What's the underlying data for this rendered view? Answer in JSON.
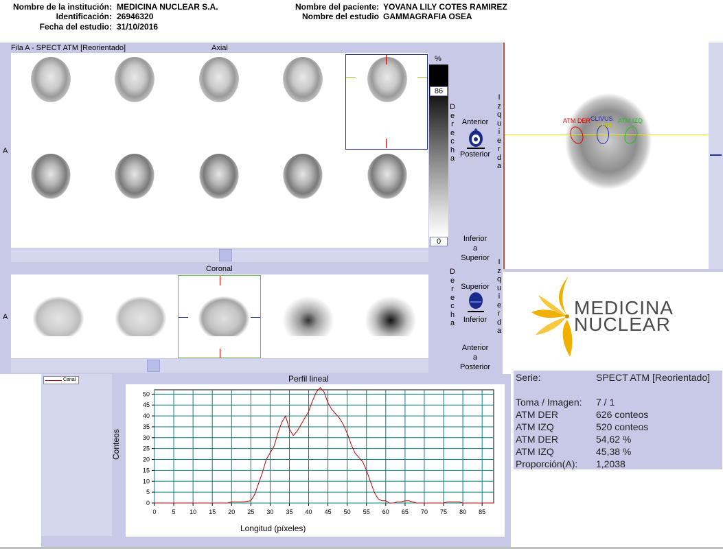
{
  "header": {
    "institution_label": "Nombre de la institución:",
    "institution": "MEDICINA NUCLEAR S.A.",
    "id_label": "Identificación:",
    "id": "26946320",
    "date_label": "Fecha del estudio:",
    "date": "31/10/2016",
    "patient_label": "Nombre del paciente:",
    "patient": "YOVANA LILY COTES RAMIREZ",
    "study_label": "Nombre del estudio",
    "study": "GAMMAGRAFIA OSEA"
  },
  "axial_panel": {
    "row_label": "Fila A - SPECT ATM [Reorientado]",
    "title": "Axial",
    "side_letter": "A"
  },
  "coronal_panel": {
    "title": "Coronal",
    "side_letter": "A"
  },
  "colorbar": {
    "unit": "%",
    "max_value": "86",
    "min_value": "0"
  },
  "orientation": {
    "derecha_letters": [
      "D",
      "e",
      "r",
      "e",
      "c",
      "h",
      "a"
    ],
    "izquierda_letters": [
      "I",
      "z",
      "q",
      "u",
      "i",
      "e",
      "r",
      "d",
      "a"
    ],
    "anterior": "Anterior",
    "posterior": "Posterior",
    "inferior_a_superior": [
      "Inferior",
      "a",
      "Superior"
    ],
    "superior": "Superior",
    "inferior": "Inferior",
    "anterior_a_posterior": [
      "Anterior",
      "a",
      "Posterior"
    ]
  },
  "roi_labels": {
    "atm_der": "ATM DER",
    "clivus": "CLIVUS",
    "perfil": "PERFIL",
    "atm_izq": "ATM IZQ"
  },
  "logo": {
    "line1": "MEDICINA",
    "line2": "NUCLEAR"
  },
  "profile": {
    "legend": "Canal",
    "title": "Perfil lineal",
    "xlabel": "Longitud (píxeles)",
    "ylabel": "Conteos"
  },
  "results": {
    "serie_label": "Serie:",
    "serie_value": "SPECT ATM [Reorientado]",
    "rows": [
      {
        "label": "Toma / Imagen:",
        "value": "7 / 1"
      },
      {
        "label": "ATM DER",
        "value": "626 conteos"
      },
      {
        "label": "ATM IZQ",
        "value": "520 conteos"
      },
      {
        "label": "ATM DER",
        "value": "54,62 %"
      },
      {
        "label": "ATM IZQ",
        "value": "45,38 %"
      },
      {
        "label": "Proporción(A):",
        "value": "1,2038"
      }
    ]
  },
  "chart_data": {
    "type": "line",
    "title": "Perfil lineal",
    "xlabel": "Longitud (píxeles)",
    "ylabel": "Conteos",
    "xlim": [
      0,
      88
    ],
    "ylim": [
      0,
      52
    ],
    "grid": true,
    "x_ticks": [
      0,
      5,
      10,
      15,
      20,
      25,
      30,
      35,
      40,
      45,
      50,
      55,
      60,
      65,
      70,
      75,
      80,
      85
    ],
    "y_ticks": [
      0,
      5,
      10,
      15,
      20,
      25,
      30,
      35,
      40,
      45,
      50
    ],
    "series": [
      {
        "name": "Canal",
        "color": "#c00000",
        "x": [
          0,
          18,
          19,
          20,
          23,
          25,
          26,
          27,
          28,
          29,
          30,
          31,
          32,
          33,
          34,
          35,
          36,
          37,
          38,
          39,
          40,
          41,
          42,
          43,
          44,
          45,
          46,
          47,
          48,
          49,
          50,
          51,
          52,
          53,
          54,
          55,
          56,
          57,
          58,
          59,
          60,
          61,
          62,
          63,
          64,
          65,
          66,
          67,
          68,
          69,
          70,
          75,
          76,
          78,
          79,
          80,
          81,
          88
        ],
        "y": [
          0,
          0,
          0,
          0.5,
          0.5,
          1,
          4,
          9,
          14,
          20,
          23,
          26,
          32,
          37,
          40,
          34,
          31,
          33,
          36,
          39,
          42,
          47,
          51,
          53,
          51,
          46,
          43,
          41,
          39,
          36,
          32,
          27,
          23,
          21,
          19,
          15,
          10,
          5,
          2,
          1,
          1,
          0,
          0,
          0.5,
          0.5,
          1,
          1,
          0.5,
          0,
          0,
          0,
          0,
          0.5,
          0.5,
          0.5,
          0,
          0,
          0
        ]
      }
    ]
  },
  "colors": {
    "panel": "#c7c9e6",
    "grid": "#008080",
    "roi_der": "#e00000",
    "roi_clivus": "#2020c0",
    "roi_izq": "#20c020",
    "profile_line": "#e6e600",
    "logo_text": "#4a4a4a",
    "logo_accent": "#f0b000"
  }
}
